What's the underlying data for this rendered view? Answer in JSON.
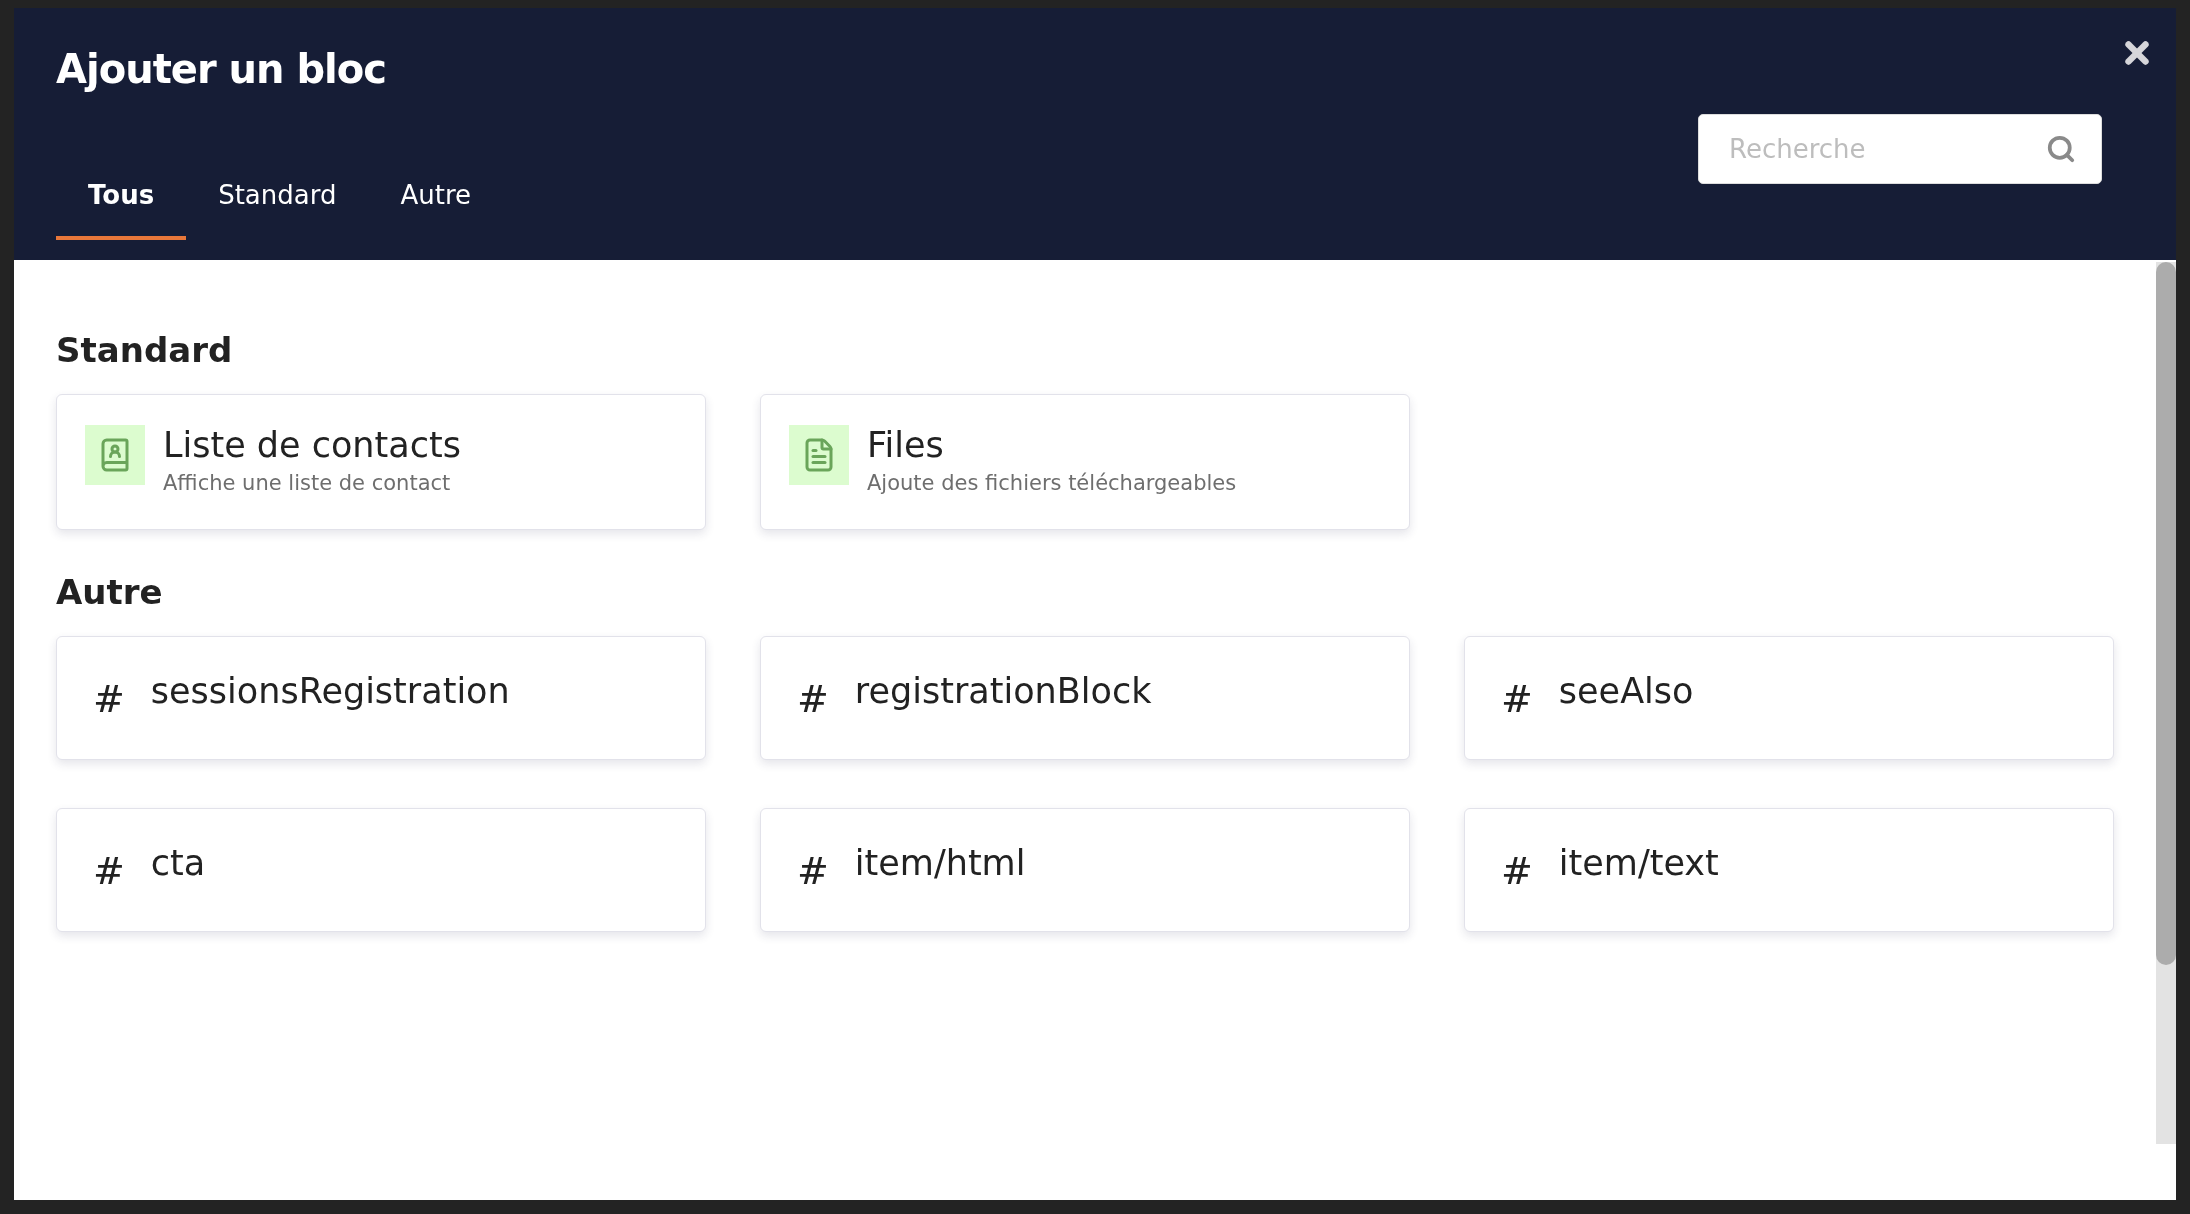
{
  "dialog": {
    "title": "Ajouter un bloc"
  },
  "tabs": [
    {
      "label": "Tous",
      "selected": true
    },
    {
      "label": "Standard",
      "selected": false
    },
    {
      "label": "Autre",
      "selected": false
    }
  ],
  "search": {
    "placeholder": "Recherche"
  },
  "sections": [
    {
      "heading": "Standard",
      "blocks": [
        {
          "kind": "contacts",
          "title": "Liste de contacts",
          "description": "Affiche une liste de contact"
        },
        {
          "kind": "file",
          "title": "Files",
          "description": "Ajoute des fichiers téléchargeables"
        }
      ]
    },
    {
      "heading": "Autre",
      "blocks": [
        {
          "kind": "hash",
          "symbol": "#",
          "title": "sessionsRegistration"
        },
        {
          "kind": "hash",
          "symbol": "#",
          "title": "registrationBlock"
        },
        {
          "kind": "hash",
          "symbol": "#",
          "title": "seeAlso"
        },
        {
          "kind": "hash",
          "symbol": "#",
          "title": "cta"
        },
        {
          "kind": "hash",
          "symbol": "#",
          "title": "item/html"
        },
        {
          "kind": "hash",
          "symbol": "#",
          "title": "item/text"
        }
      ]
    }
  ]
}
